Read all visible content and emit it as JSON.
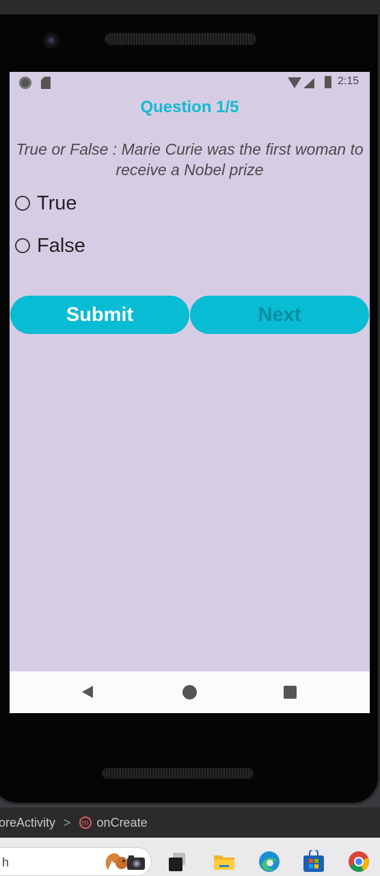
{
  "status_bar": {
    "time": "2:15"
  },
  "quiz": {
    "counter": "Question 1/5",
    "question": "True or False : Marie Curie was the first woman to receive a Nobel prize",
    "options": [
      "True",
      "False"
    ]
  },
  "buttons": {
    "submit": "Submit",
    "next": "Next"
  },
  "ide": {
    "activity": "oreActivity",
    "separator": ">",
    "method_badge": "m",
    "method": "onCreate"
  },
  "taskbar": {
    "search_partial": "h"
  },
  "colors": {
    "accent": "#08bcd3",
    "title": "#13b9d4",
    "screen_bg": "#d6cde5",
    "next_text": "#0a8ea2"
  }
}
